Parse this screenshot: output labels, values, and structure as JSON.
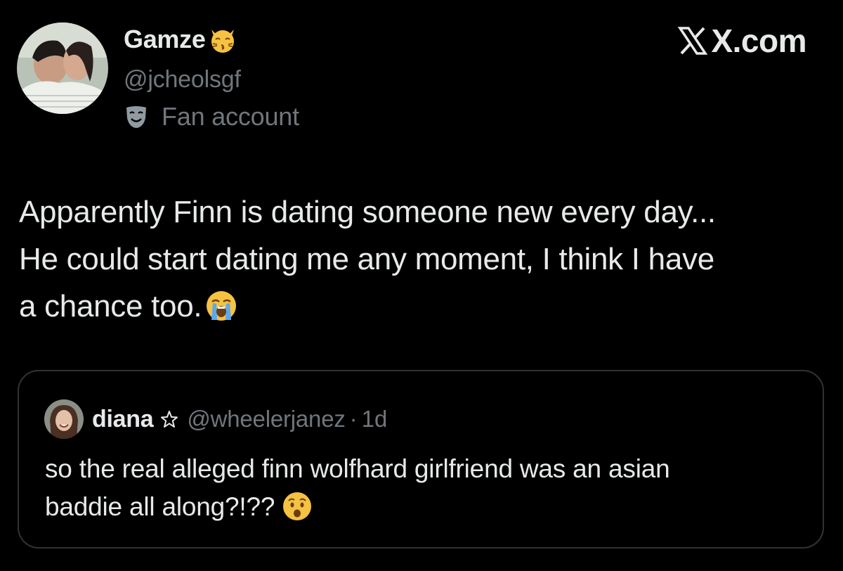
{
  "post": {
    "author": {
      "display_name": "Gamze",
      "name_emoji": "kissing-cat-face-icon",
      "handle": "@jcheolsgf",
      "label_icon": "theater-mask-icon",
      "label": "Fan account"
    },
    "brand": "X.com",
    "text_lines": [
      "Apparently Finn is dating someone new every day...",
      "He could start dating me any moment, I think I have",
      "a chance too."
    ],
    "text_emoji": "loudly-crying-face-icon"
  },
  "quote": {
    "author": {
      "display_name": "diana",
      "badge_icon": "star-outline-icon",
      "handle": "@wheelerjanez",
      "separator": "·",
      "time": "1d"
    },
    "text_lines": [
      "so the real alleged finn wolfhard girlfriend was an asian",
      "baddie all along?!??"
    ],
    "text_emoji": "anxious-face-icon"
  },
  "colors": {
    "background": "#000000",
    "text_primary": "#e7e9ea",
    "text_secondary": "#71767b",
    "border": "#2f3336"
  }
}
